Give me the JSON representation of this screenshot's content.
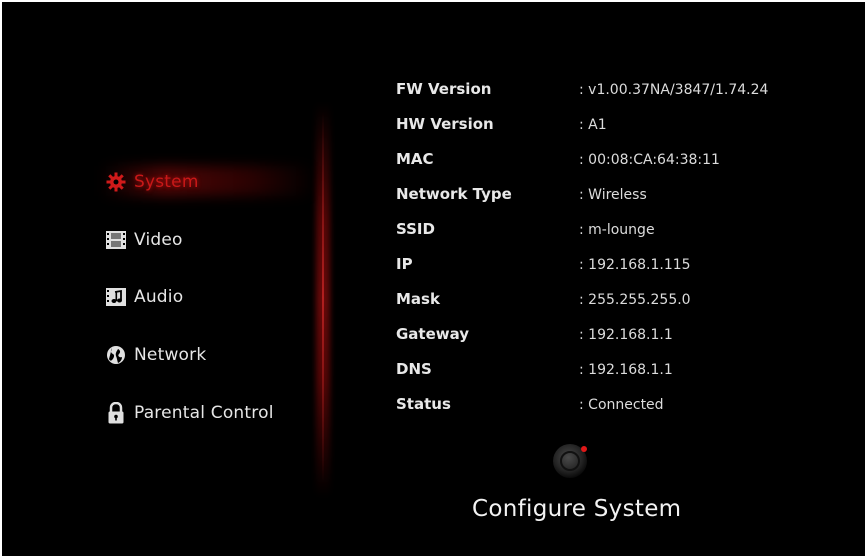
{
  "menu": {
    "items": [
      {
        "label": "System",
        "icon": "gear-icon",
        "active": true
      },
      {
        "label": "Video",
        "icon": "film-icon",
        "active": false
      },
      {
        "label": "Audio",
        "icon": "music-icon",
        "active": false
      },
      {
        "label": "Network",
        "icon": "globe-icon",
        "active": false
      },
      {
        "label": "Parental Control",
        "icon": "lock-icon",
        "active": false
      }
    ]
  },
  "system_info": {
    "rows": [
      {
        "key": "FW Version",
        "value": ": v1.00.37NA/3847/1.74.24"
      },
      {
        "key": "HW Version",
        "value": ": A1"
      },
      {
        "key": "MAC",
        "value": ": 00:08:CA:64:38:11"
      },
      {
        "key": "Network Type",
        "value": ": Wireless"
      },
      {
        "key": "SSID",
        "value": ": m-lounge"
      },
      {
        "key": "IP",
        "value": ": 192.168.1.115"
      },
      {
        "key": "Mask",
        "value": ": 255.255.255.0"
      },
      {
        "key": "Gateway",
        "value": ": 192.168.1.1"
      },
      {
        "key": "DNS",
        "value": ": 192.168.1.1"
      },
      {
        "key": "Status",
        "value": ": Connected"
      }
    ]
  },
  "footer": {
    "title": "Configure System",
    "icon": "settings-dial-icon"
  },
  "colors": {
    "background": "#000000",
    "accent": "#c81818",
    "text": "#e6e6e6"
  }
}
